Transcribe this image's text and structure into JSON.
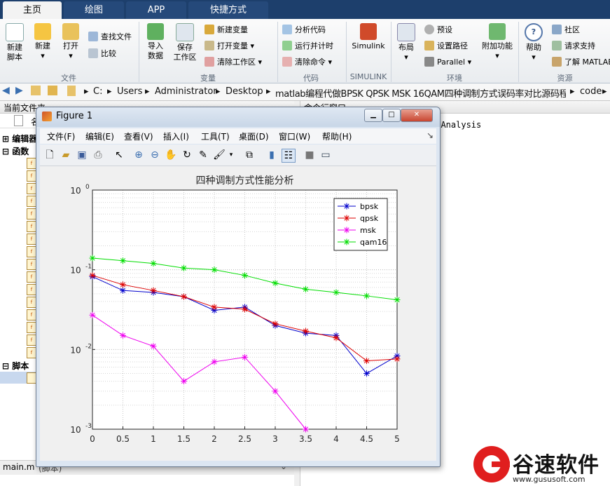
{
  "ribbon": {
    "tabs": [
      "主页",
      "绘图",
      "APP",
      "快捷方式"
    ],
    "file_group": {
      "new_script": "新建\n脚本",
      "new": "新建",
      "open": "打开",
      "find_files": "查找文件",
      "compare": "比较",
      "label": "文件"
    },
    "variable_group": {
      "import": "导入\n数据",
      "save_ws": "保存\n工作区",
      "new_var": "新建变量",
      "open_var": "打开变量",
      "clear_ws": "清除工作区",
      "label": "变量"
    },
    "code_group": {
      "analyze": "分析代码",
      "run_time": "运行并计时",
      "clear_cmd": "清除命令",
      "label": "代码"
    },
    "simulink_group": {
      "simulink": "Simulink",
      "label": "SIMULINK"
    },
    "env_group": {
      "layout": "布局",
      "prefs": "预设",
      "set_path": "设置路径",
      "parallel": "Parallel",
      "addons": "附加功能",
      "label": "环境"
    },
    "resources_group": {
      "help": "帮助",
      "community": "社区",
      "support": "请求支持",
      "learn": "了解 MATLAB",
      "label": "资源"
    }
  },
  "address": {
    "crumbs": [
      "C:",
      "Users",
      "Administrator",
      "Desktop",
      "matlab编程代做BPSK QPSK MSK 16QAM四种调制方式误码率对比源码程序",
      "code"
    ]
  },
  "left_panel": {
    "title": "当前文件夹",
    "col_name": "名",
    "editor_label": "编辑器",
    "functions_label": "函数",
    "scripts_label": "脚本",
    "file_footer": "main.m",
    "file_footer_kind": "(脚本)"
  },
  "right_panel": {
    "title": "命令行窗口",
    "text": "e Analysis"
  },
  "figure": {
    "title": "Figure 1",
    "menu": [
      "文件(F)",
      "编辑(E)",
      "查看(V)",
      "插入(I)",
      "工具(T)",
      "桌面(D)",
      "窗口(W)",
      "帮助(H)"
    ]
  },
  "chart_data": {
    "type": "line",
    "title": "四种调制方式性能分析",
    "xlabel": "",
    "ylabel": "",
    "x": [
      0,
      0.5,
      1,
      1.5,
      2,
      2.5,
      3,
      3.5,
      4,
      4.5,
      5
    ],
    "xlim": [
      0,
      5
    ],
    "ylim": [
      0.001,
      1
    ],
    "yscale": "log",
    "x_ticks": [
      "0",
      "0.5",
      "1",
      "1.5",
      "2",
      "2.5",
      "3",
      "3.5",
      "4",
      "4.5",
      "5"
    ],
    "y_ticks": [
      {
        "base": "10",
        "exp": "0"
      },
      {
        "base": "10",
        "exp": "-1"
      },
      {
        "base": "10",
        "exp": "-2"
      },
      {
        "base": "10",
        "exp": "-3"
      }
    ],
    "grid": true,
    "legend_position": "top-right",
    "series": [
      {
        "name": "bpsk",
        "color": "#0000cc",
        "values": [
          0.082,
          0.055,
          0.052,
          0.046,
          0.031,
          0.034,
          0.02,
          0.016,
          0.015,
          0.005,
          0.0083
        ]
      },
      {
        "name": "qpsk",
        "color": "#dd0000",
        "values": [
          0.085,
          0.065,
          0.055,
          0.046,
          0.034,
          0.032,
          0.021,
          0.017,
          0.014,
          0.0072,
          0.0076
        ]
      },
      {
        "name": "msk",
        "color": "#ee00ee",
        "values": [
          0.027,
          0.015,
          0.011,
          0.004,
          0.007,
          0.008,
          0.003,
          0.001,
          null,
          null,
          null
        ]
      },
      {
        "name": "qam16",
        "color": "#00dd00",
        "values": [
          0.14,
          0.13,
          0.12,
          0.105,
          0.1,
          0.085,
          0.068,
          0.057,
          0.052,
          0.047,
          0.042
        ]
      }
    ]
  },
  "watermark": {
    "brand": "谷速软件",
    "url": "www.gususoft.com"
  }
}
